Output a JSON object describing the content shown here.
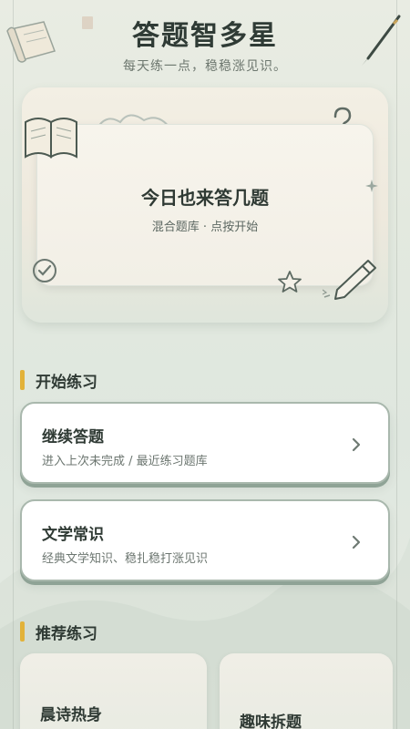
{
  "header": {
    "title": "答题智多星",
    "subtitle": "每天练一点，稳稳涨见识。"
  },
  "hero": {
    "title": "今日也来答几题",
    "subtitle": "混合题库 · 点按开始"
  },
  "sections": {
    "practice": "开始练习",
    "recommended": "推荐练习"
  },
  "practice_cards": [
    {
      "title": "继续答题",
      "desc": "进入上次未完成 / 最近练习题库"
    },
    {
      "title": "文学常识",
      "desc": "经典文学知识、稳扎稳打涨见识"
    }
  ],
  "recommended_cards": [
    {
      "title": "晨诗热身"
    },
    {
      "title": "趣味拆题"
    }
  ],
  "colors": {
    "accent": "#e2b23a",
    "card_border": "#a9b8ad",
    "text_primary": "#2f3a34"
  },
  "icons": [
    "scroll-icon",
    "brush-icon",
    "book-icon",
    "question-icon",
    "star-icon",
    "pencil-icon",
    "check-stamp-icon",
    "chevron-right-icon"
  ]
}
